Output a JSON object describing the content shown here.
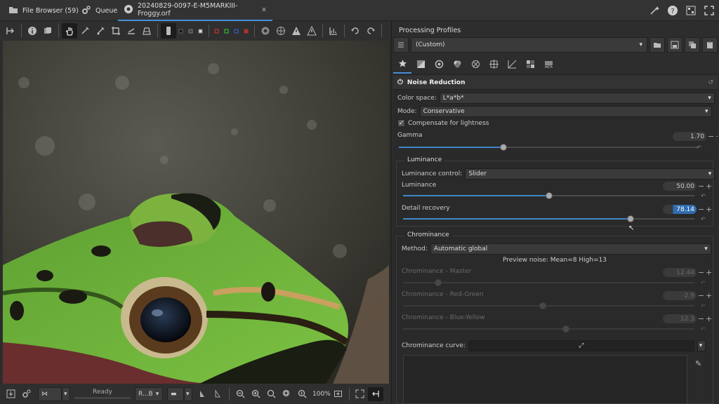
{
  "tabs": [
    {
      "label": "File Browser (59)",
      "icon": "folder-icon"
    },
    {
      "label": "Queue",
      "icon": "gears-icon"
    },
    {
      "label": "20240829-0097-E-M5MARKIII-Froggy.orf",
      "icon": "aperture-icon"
    }
  ],
  "bottom": {
    "status": "Ready",
    "channel": "R...B",
    "zoom": "100%"
  },
  "profiles": {
    "title": "Processing Profiles",
    "value": "(Custom)"
  },
  "nr": {
    "title": "Noise Reduction",
    "color_space_label": "Color space:",
    "color_space": "L*a*b*",
    "mode_label": "Mode:",
    "mode": "Conservative",
    "compensate_label": "Compensate for lightness",
    "compensate_checked": true,
    "gamma_label": "Gamma",
    "gamma": "1.70",
    "gamma_frac": 0.35,
    "luminance_title": "Luminance",
    "lum_control_label": "Luminance control:",
    "lum_control": "Slider",
    "luminance_label": "Luminance",
    "luminance": "50.00",
    "luminance_frac": 0.5,
    "detail_label": "Detail recovery",
    "detail": "78.14",
    "detail_frac": 0.7814,
    "chrom_title": "Chrominance",
    "method_label": "Method:",
    "method": "Automatic global",
    "preview": "Preview noise: Mean=8  High=13",
    "master_label": "Chrominance - Master",
    "master": "12.44",
    "master_frac": 0.12,
    "rg_label": "Chrominance - Red-Green",
    "rg": "-2.9",
    "rg_frac": 0.48,
    "by_label": "Chrominance - Blue-Yellow",
    "by": "12.3",
    "by_frac": 0.56,
    "curve_label": "Chrominance curve:"
  },
  "colors": {
    "accent": "#3f86c9",
    "frog_green": "#6fb03a"
  }
}
